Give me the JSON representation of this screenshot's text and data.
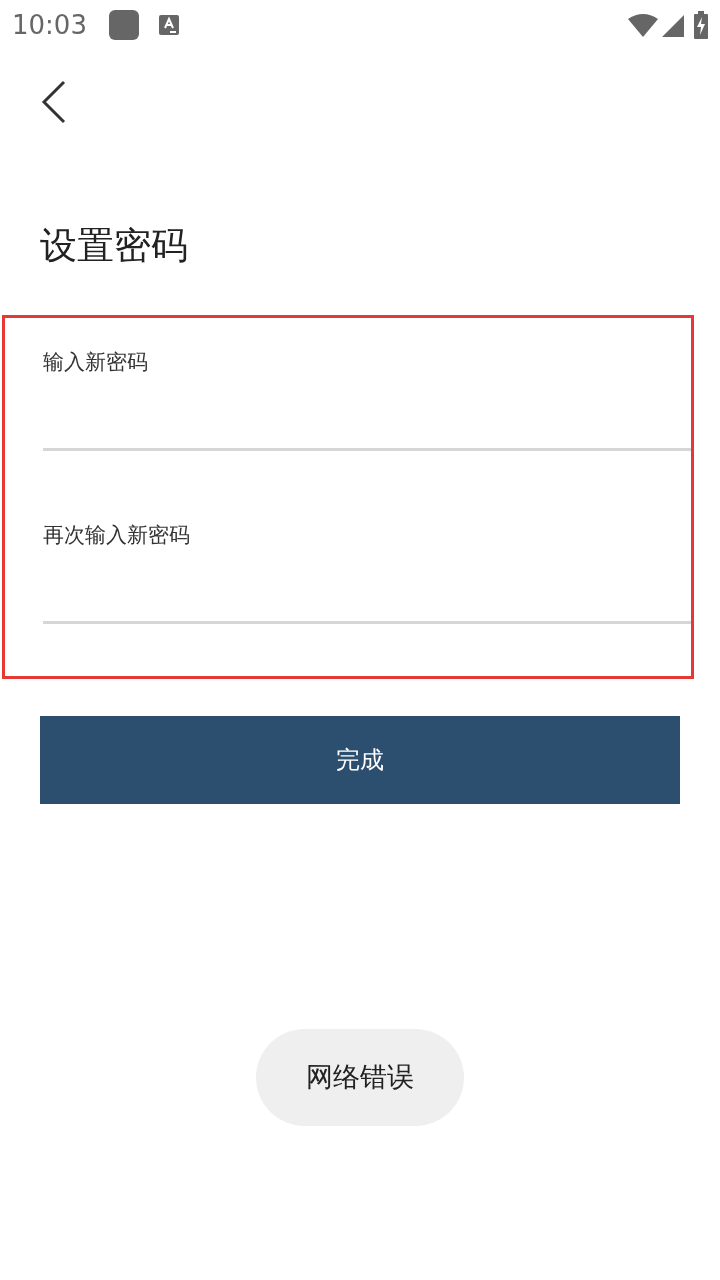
{
  "status_bar": {
    "time": "10:03"
  },
  "title": "设置密码",
  "form": {
    "highlighted": true,
    "fields": [
      {
        "label": "输入新密码"
      },
      {
        "label": "再次输入新密码"
      }
    ]
  },
  "submit_button": "完成",
  "toast": "网络错误"
}
